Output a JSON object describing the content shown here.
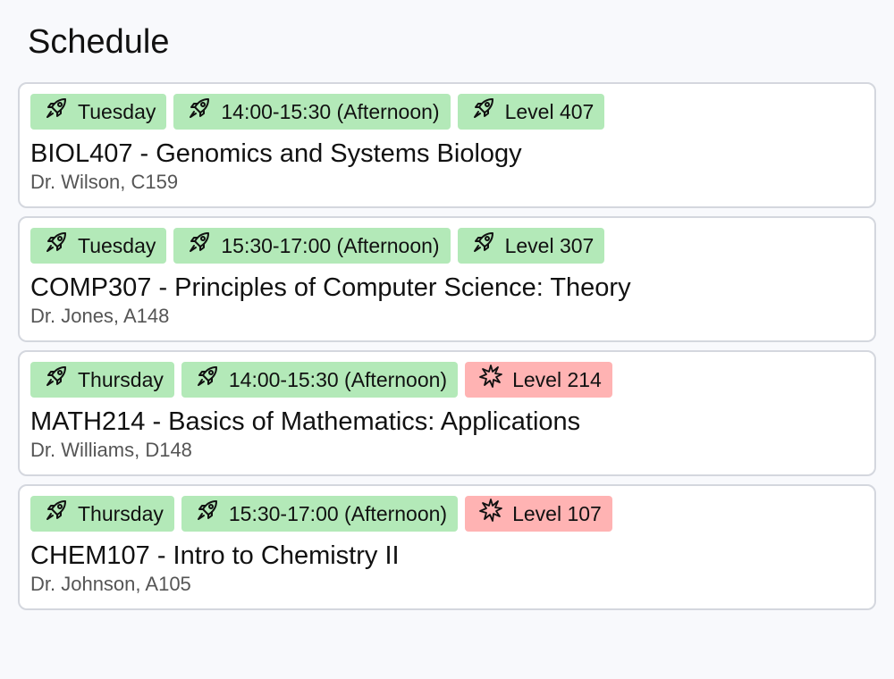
{
  "page": {
    "title": "Schedule"
  },
  "colors": {
    "tag_green": "#b3e9b8",
    "tag_red": "#ffb3b3",
    "card_border": "#d4d7de",
    "background": "#f8f9fc"
  },
  "courses": [
    {
      "tags": [
        {
          "label": "Tuesday",
          "icon": "rocket-icon",
          "color": "green"
        },
        {
          "label": "14:00-15:30 (Afternoon)",
          "icon": "rocket-icon",
          "color": "green"
        },
        {
          "label": "Level 407",
          "icon": "rocket-icon",
          "color": "green"
        }
      ],
      "title": "BIOL407 - Genomics and Systems Biology",
      "meta": "Dr. Wilson, C159"
    },
    {
      "tags": [
        {
          "label": "Tuesday",
          "icon": "rocket-icon",
          "color": "green"
        },
        {
          "label": "15:30-17:00 (Afternoon)",
          "icon": "rocket-icon",
          "color": "green"
        },
        {
          "label": "Level 307",
          "icon": "rocket-icon",
          "color": "green"
        }
      ],
      "title": "COMP307 - Principles of Computer Science: Theory",
      "meta": "Dr. Jones, A148"
    },
    {
      "tags": [
        {
          "label": "Thursday",
          "icon": "rocket-icon",
          "color": "green"
        },
        {
          "label": "14:00-15:30 (Afternoon)",
          "icon": "rocket-icon",
          "color": "green"
        },
        {
          "label": "Level 214",
          "icon": "explosion-icon",
          "color": "red"
        }
      ],
      "title": "MATH214 - Basics of Mathematics: Applications",
      "meta": "Dr. Williams, D148"
    },
    {
      "tags": [
        {
          "label": "Thursday",
          "icon": "rocket-icon",
          "color": "green"
        },
        {
          "label": "15:30-17:00 (Afternoon)",
          "icon": "rocket-icon",
          "color": "green"
        },
        {
          "label": "Level 107",
          "icon": "explosion-icon",
          "color": "red"
        }
      ],
      "title": "CHEM107 - Intro to Chemistry II",
      "meta": "Dr. Johnson, A105"
    }
  ]
}
